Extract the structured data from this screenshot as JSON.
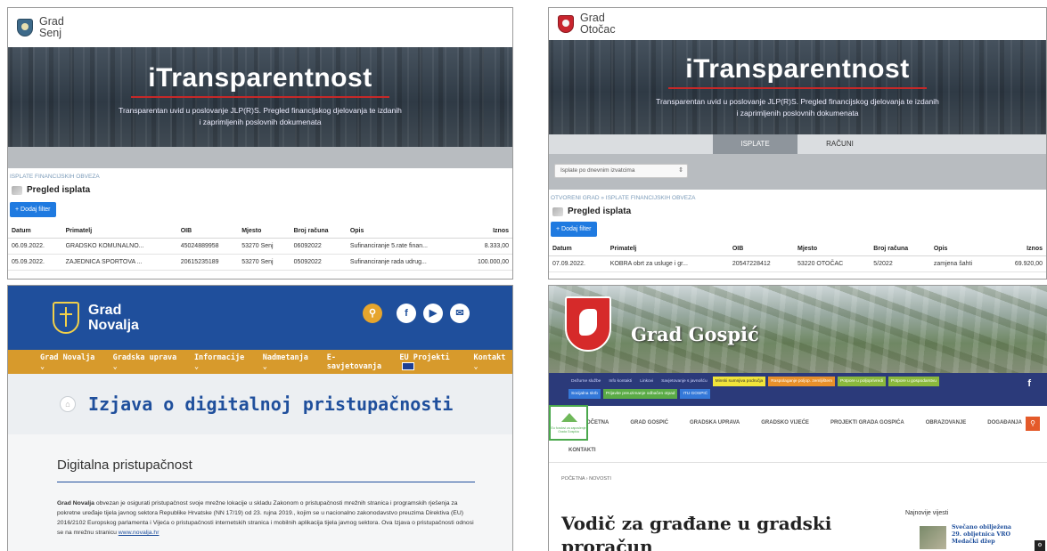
{
  "senj": {
    "city_line1": "Grad",
    "city_line2": "Senj",
    "hero_title": "iTransparentnost",
    "hero_subtitle": "Transparentan uvid u poslovanje JLP(R)S. Pregled financijskog djelovanja te izdanih i zaprimljenih poslovnih dokumenata",
    "breadcrumb": "ISPLATE FINANCIJSKIH OBVEZA",
    "section_title": "Pregled isplata",
    "filter_button": "+ Dodaj filter",
    "columns": [
      "Datum",
      "Primatelj",
      "OIB",
      "Mjesto",
      "Broj računa",
      "Opis",
      "Iznos"
    ],
    "rows": [
      [
        "06.09.2022.",
        "GRADSKO KOMUNALNO...",
        "45024889958",
        "53270 Senj",
        "06092022",
        "Sufinanciranje 5.rate finan...",
        "8.333,00"
      ],
      [
        "05.09.2022.",
        "ZAJEDNICA SPORTOVA ...",
        "20615235189",
        "53270 Senj",
        "05092022",
        "Sufinanciranje rada udrug...",
        "100.000,00"
      ]
    ]
  },
  "otocac": {
    "city_line1": "Grad",
    "city_line2": "Otočac",
    "hero_title": "iTransparentnost",
    "hero_subtitle": "Transparentan uvid u poslovanje JLP(R)S. Pregled financijskog djelovanja te izdanih i zaprimljenih poslovnih dokumenata",
    "tabs": [
      "ISPLATE",
      "RAČUNI"
    ],
    "select_value": "Isplate po dnevnim izvatcima",
    "breadcrumb": "OTVORENI GRAD  »  ISPLATE FINANCIJSKIH OBVEZA",
    "section_title": "Pregled isplata",
    "filter_button": "+ Dodaj filter",
    "columns": [
      "Datum",
      "Primatelj",
      "OIB",
      "Mjesto",
      "Broj računa",
      "Opis",
      "Iznos"
    ],
    "rows": [
      [
        "07.09.2022.",
        "KOBRA obrt za usluge i gr...",
        "20547228412",
        "53220 OTOČAC",
        "5/2022",
        "zamjena šahti",
        "69.920,00"
      ]
    ]
  },
  "novalja": {
    "city_line1": "Grad",
    "city_line2": "Novalja",
    "nav": [
      "Grad Novalja ⌄",
      "Gradska uprava ⌄",
      "Informacije ⌄",
      "Nadmetanja ⌄",
      "E-savjetovanja",
      "EU Projekti",
      "Kontakt ⌄"
    ],
    "page_title": "Izjava o digitalnoj pristupačnosti",
    "section_heading": "Digitalna pristupačnost",
    "para_bold": "Grad Novalja",
    "para_text": " obvezan je osigurati pristupačnost svoje mrežne lokacije u skladu Zakonom o pristupačnosti mrežnih stranica i programskih rješenja za pokretne uređaje tijela javnog sektora Republike Hrvatske (NN 17/19) od 23. rujna 2019., kojim se u nacionalno zakonodavstvo preuzima Direktiva (EU) 2016/2102 Europskog parlamenta i Vijeća o pristupačnosti internetskih stranica i mobilnih aplikacija tijela javnog sektora. Ova Izjava o pristupačnosti odnosi se na mrežnu stranicu ",
    "para_link": "www.novalja.hr"
  },
  "gospic": {
    "city_name": "Grad Gospić",
    "quick_links_row1": [
      "Dežurne službe",
      "Info kontakti",
      "Linkovi",
      "Savjetovanje s javnošću",
      "Minski sumnjiva područja",
      "Raspolaganje poljop. zemljištem",
      "Potpore u poljoprivredi",
      "Potpore u gospodarstvu"
    ],
    "quick_links_row2": [
      "Socijalna skrb",
      "Prijavite preuzimanje odbačen otpad",
      "ITU GOSPIĆ"
    ],
    "logo_text": "Eu fondovi za zaposlenje Grada Gospića",
    "nav": [
      "POČETNA",
      "GRAD GOSPIĆ",
      "GRADSKA UPRAVA",
      "GRADSKO VIJEĆE",
      "PROJEKTI GRADA GOSPIĆA",
      "OBRAZOVANJE",
      "DOGAĐANJA"
    ],
    "nav_extra": "KONTAKTI",
    "breadcrumb": "POČETNA   ›   NOVOSTI",
    "article_title": "Vodič za građane u gradski proračun",
    "sidebar_title": "Najnovije vijesti",
    "news_item": "Svečano obilježena 29. obljetnica VRO Medački džep"
  }
}
